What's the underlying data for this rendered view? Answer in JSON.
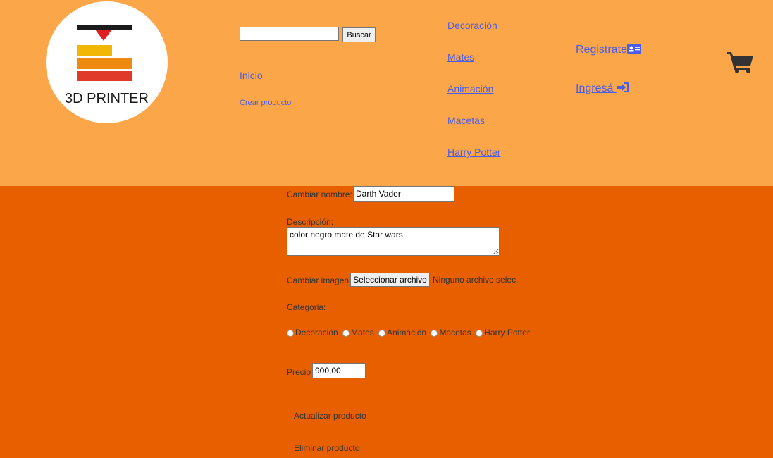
{
  "logo": {
    "text": "3D PRINTER"
  },
  "search": {
    "value": "",
    "button_label": "Buscar"
  },
  "nav": {
    "inicio": "Inicio",
    "crear_producto": "Crear producto",
    "categories": [
      "Decoración",
      "Mates",
      "Animación",
      "Macetas",
      "Harry Potter"
    ],
    "registrate": "Registrate",
    "ingresa": "Ingresá"
  },
  "icons": {
    "registrate": "id-card-icon",
    "ingresa": "sign-in-icon",
    "cart": "shopping-cart-icon"
  },
  "colors": {
    "header_bg": "#fca64a",
    "page_bg": "#e85f00",
    "link": "#4a5de8"
  },
  "form": {
    "nombre_label": "Cambiar nombre:",
    "nombre_value": "Darth Vader",
    "descripcion_label": "Descripción:",
    "descripcion_value": "color negro mate de Star wars",
    "imagen_label": "Cambiar imagen",
    "file_button_label": "Seleccionar archivo",
    "file_status": "Ninguno archivo selec.",
    "categoria_label": "Categoria:",
    "categoria_options": [
      "Decoración",
      "Mates",
      "Animación",
      "Macetas",
      "Harry Potter"
    ],
    "precio_label": "Precio",
    "precio_value": "900,00",
    "actualizar_label": "Actualizar producto",
    "eliminar_label": "Eliminar producto"
  }
}
